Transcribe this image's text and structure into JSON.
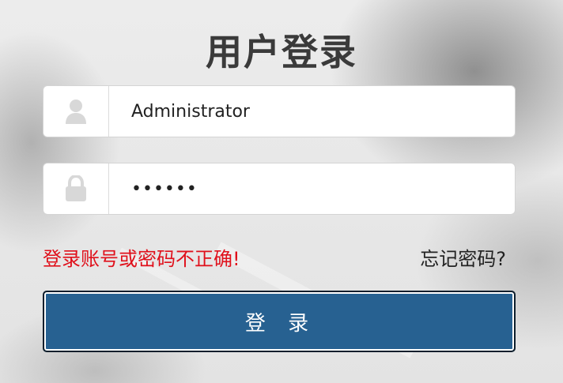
{
  "login": {
    "title": "用户登录",
    "username": {
      "value": "Administrator",
      "icon": "user-icon"
    },
    "password": {
      "value": "••••••",
      "icon": "lock-icon"
    },
    "error_message": "登录账号或密码不正确!",
    "forgot_password": "忘记密码?",
    "submit_label": "登 录"
  },
  "colors": {
    "accent": "#276191",
    "error": "#e0101b",
    "title": "#3a3a3a"
  }
}
